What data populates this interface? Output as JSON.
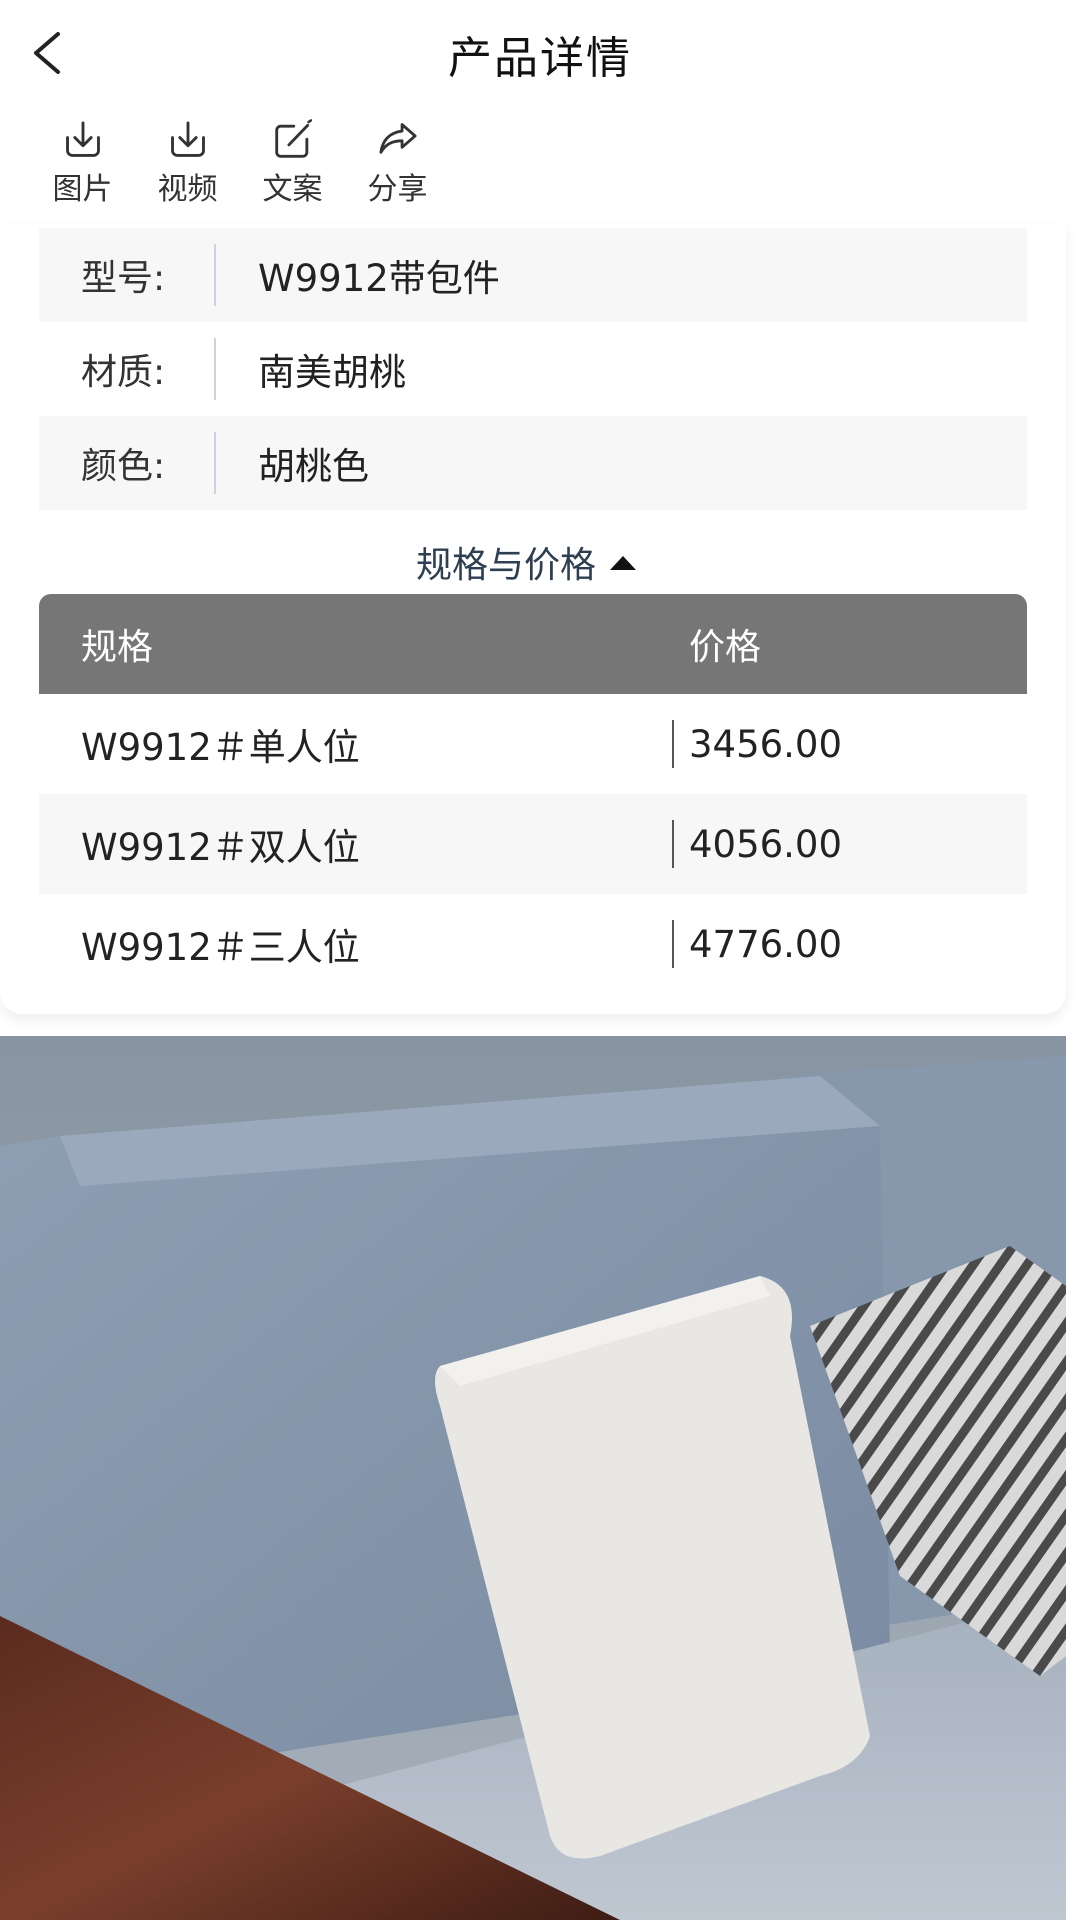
{
  "header": {
    "title": "产品详情",
    "back_icon": "chevron-left-icon"
  },
  "toolbar": [
    {
      "label": "图片",
      "icon": "download-icon"
    },
    {
      "label": "视频",
      "icon": "download-icon"
    },
    {
      "label": "文案",
      "icon": "edit-icon"
    },
    {
      "label": "分享",
      "icon": "share-icon"
    }
  ],
  "attributes": [
    {
      "key": "型号:",
      "value": "W9912带包件"
    },
    {
      "key": "材质:",
      "value": "南美胡桃"
    },
    {
      "key": "颜色:",
      "value": "胡桃色"
    }
  ],
  "spec_section": {
    "toggle_label": "规格与价格",
    "toggle_icon": "caret-up-icon",
    "columns": [
      "规格",
      "价格"
    ],
    "rows": [
      {
        "spec": "W9912＃单人位",
        "price": "3456.00"
      },
      {
        "spec": "W9912＃双人位",
        "price": "4056.00"
      },
      {
        "spec": "W9912＃三人位",
        "price": "4776.00"
      }
    ]
  },
  "colors": {
    "table_header": "#767676",
    "row_shade": "#f7f7f7",
    "accent_text": "#2e3f52"
  }
}
